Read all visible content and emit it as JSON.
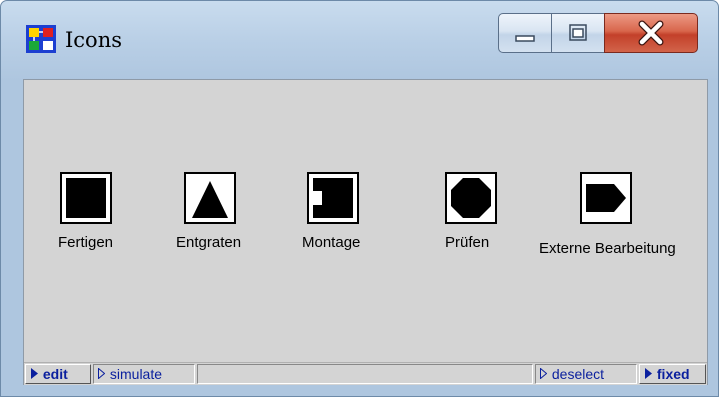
{
  "window": {
    "title": "Icons",
    "app_icon": "app-logo-icon",
    "controls": {
      "minimize": "minimize-icon",
      "maximize": "maximize-icon",
      "close": "close-icon"
    }
  },
  "icons": [
    {
      "label": "Fertigen",
      "symbol": "filled-square"
    },
    {
      "label": "Entgraten",
      "symbol": "filled-triangle"
    },
    {
      "label": "Montage",
      "symbol": "notched-square"
    },
    {
      "label": "Prüfen",
      "symbol": "filled-octagon"
    },
    {
      "label": "Externe Bearbeitung",
      "symbol": "pentagon-arrow"
    }
  ],
  "statusbar": {
    "edit": "edit",
    "simulate": "simulate",
    "deselect": "deselect",
    "fixed": "fixed"
  },
  "colors": {
    "accent_blue": "#0a1f9e",
    "close_red": "#c3402a",
    "canvas_gray": "#d4d4d4"
  }
}
